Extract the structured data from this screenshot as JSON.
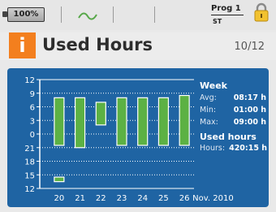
{
  "status": {
    "battery_label": "100%",
    "program_name": "Prog 1",
    "program_state": "ST"
  },
  "header": {
    "info_icon": "i",
    "title": "Used Hours",
    "page": "10/12"
  },
  "chart_data": {
    "type": "bar",
    "categories": [
      "20",
      "21",
      "22",
      "23",
      "24",
      "25",
      "26"
    ],
    "x_tail_label": "Nov.   2010",
    "y_tick_labels": [
      "12",
      "9",
      "6",
      "3",
      "0",
      "21",
      "18",
      "15",
      "12"
    ],
    "series": [
      {
        "ranges": [
          {
            "start": 8.0,
            "end": 21.5
          },
          {
            "start": 8.0,
            "end": 21.0
          },
          {
            "start": 7.0,
            "end": 2.0
          },
          {
            "start": 8.0,
            "end": 21.5
          },
          {
            "start": 8.0,
            "end": 21.5
          },
          {
            "start": 8.0,
            "end": 21.5
          },
          {
            "start": 8.5,
            "end": 21.5
          }
        ]
      }
    ],
    "extra_marks": [
      {
        "category": "20",
        "start": 14.5,
        "end": 13.5
      }
    ],
    "colors": {
      "bar": "#5cb144",
      "bar_border": "#ffffff",
      "grid": "#ffffff",
      "panel": "#1f64a3"
    }
  },
  "stats": {
    "week_title": "Week",
    "avg_label": "Avg:",
    "avg_value": "08:17 h",
    "min_label": "Min:",
    "min_value": "01:00 h",
    "max_label": "Max:",
    "max_value": "09:00 h",
    "used_title": "Used hours",
    "hours_label": "Hours:",
    "hours_value": "420:15 h"
  },
  "colors": {
    "accent": "#f37f1e",
    "panel": "#1f64a3",
    "lock": "#f2c230"
  }
}
